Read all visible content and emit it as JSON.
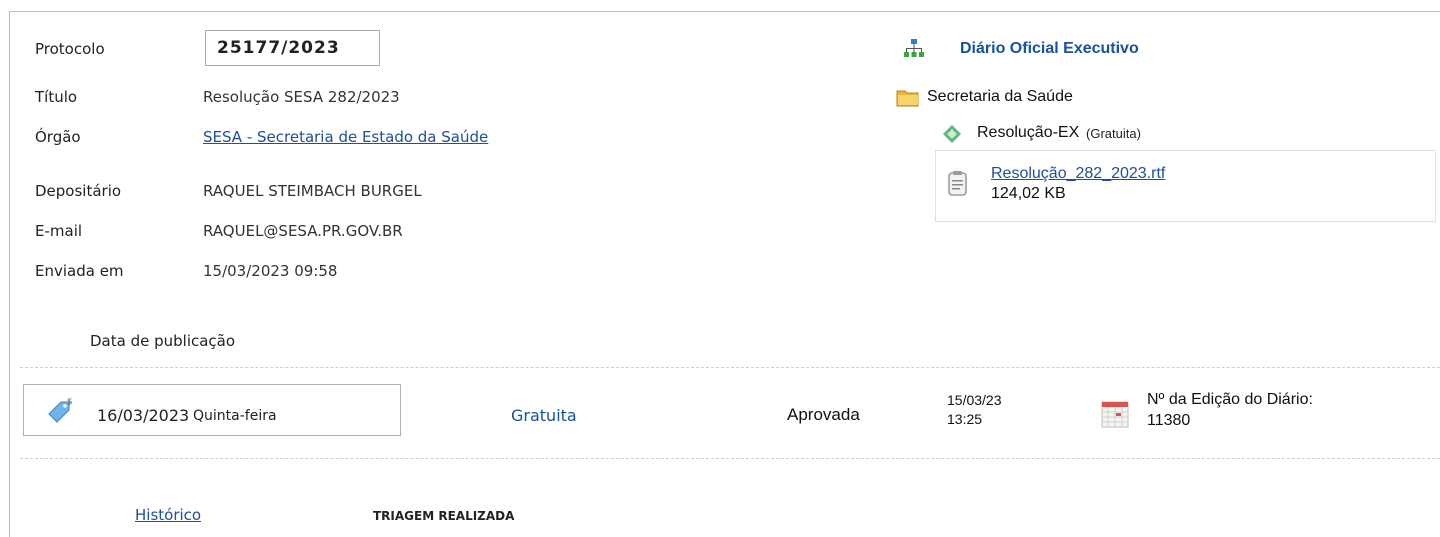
{
  "fields": {
    "protocolo_label": "Protocolo",
    "protocolo_value": "25177/2023",
    "titulo_label": "Título",
    "titulo_value": "Resolução SESA 282/2023",
    "orgao_label": "Órgão",
    "orgao_value": "SESA - Secretaria de Estado da Saúde",
    "depositario_label": "Depositário",
    "depositario_value": "RAQUEL STEIMBACH BURGEL",
    "email_label": "E-mail",
    "email_value": "RAQUEL@SESA.PR.GOV.BR",
    "enviada_label": "Enviada em",
    "enviada_value": "15/03/2023 09:58"
  },
  "tree": {
    "root_label": "Diário Oficial Executivo",
    "folder_label": "Secretaria da Saúde",
    "type_label": "Resolução-EX",
    "type_note": "(Gratuita)",
    "file_name": "Resolução_282_2023.rtf",
    "file_size": "124,02 KB"
  },
  "publication": {
    "section_label": "Data de publicação",
    "date": "16/03/2023",
    "weekday": "Quinta-feira",
    "cost": "Gratuita",
    "status": "Aprovada",
    "approved_date": "15/03/23",
    "approved_time": "13:25",
    "edition_label": "Nº da Edição do Diário:",
    "edition_number": "11380"
  },
  "history": {
    "link_label": "Histórico",
    "status": "TRIAGEM REALIZADA"
  },
  "colors": {
    "link": "#1a4fa3",
    "title_blue": "#1a4fa3"
  },
  "icons": {
    "tree_root": "sitemap-icon",
    "folder": "folder-icon",
    "type": "diamond-arrows-icon",
    "file": "document-icon",
    "date": "price-tag-icon",
    "calendar": "calendar-icon"
  }
}
